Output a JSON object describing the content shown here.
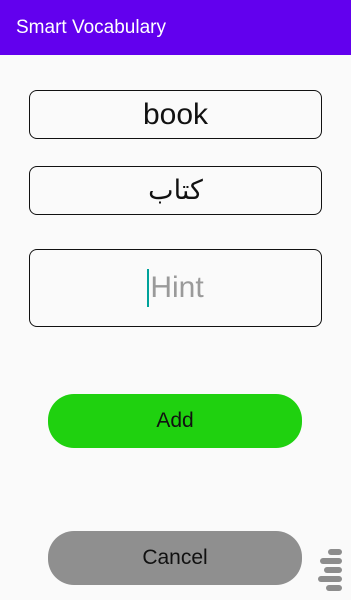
{
  "app_bar": {
    "title": "Smart Vocabulary"
  },
  "form": {
    "word_value": "book",
    "translation_value": "كتاب",
    "hint_placeholder": "Hint"
  },
  "buttons": {
    "add_label": "Add",
    "cancel_label": "Cancel"
  },
  "colors": {
    "app_bar": "#6200ee",
    "add_button": "#1fd10f",
    "cancel_button": "#8f8f8f",
    "caret": "#00a29a"
  },
  "icons": {
    "watermark": "store-logo-icon"
  }
}
